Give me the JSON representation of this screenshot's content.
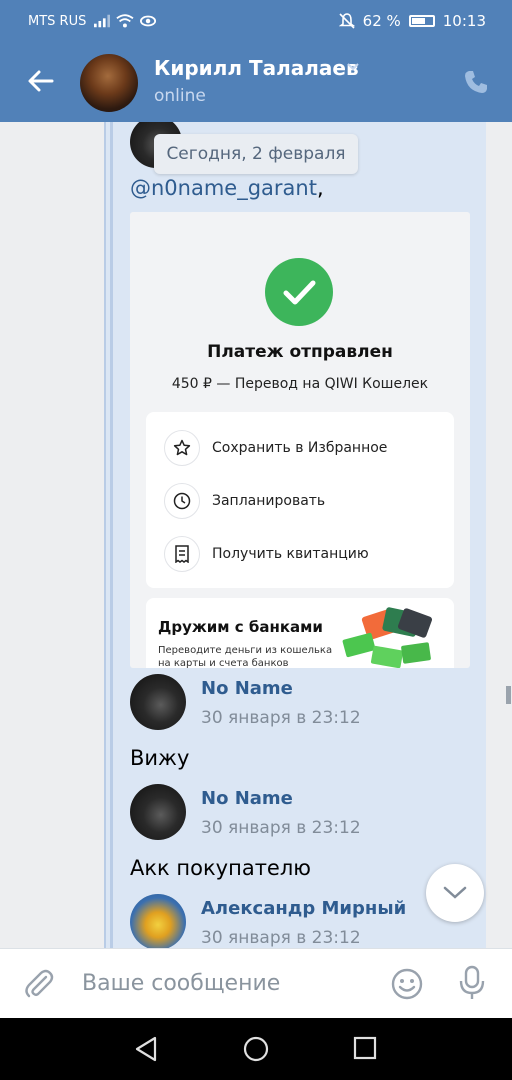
{
  "status_bar": {
    "carrier": "MTS RUS",
    "battery": "62 %",
    "time": "10:13"
  },
  "header": {
    "name": "Кирилл Талалаев",
    "status": "online"
  },
  "chat": {
    "date_pill": "Сегодня, 2 февраля",
    "mention": {
      "link": "@n0name_garant",
      "suffix": ","
    },
    "card": {
      "title": "Платеж отправлен",
      "subtitle": "450 ₽ — Перевод на QIWI Кошелек",
      "actions": [
        {
          "label": "Сохранить в Избранное",
          "icon": "star-icon"
        },
        {
          "label": "Запланировать",
          "icon": "clock-icon"
        },
        {
          "label": "Получить квитанцию",
          "icon": "receipt-icon"
        }
      ],
      "promo": {
        "title": "Дружим с банками",
        "text": "Переводите деньги из кошелька на карты и счета банков"
      }
    },
    "messages": [
      {
        "name": "No Name",
        "time": "30 января в 23:12",
        "text": "Вижу"
      },
      {
        "name": "No Name",
        "time": "30 января в 23:12",
        "text": "Акк покупателю"
      },
      {
        "name": "Александр Мирный",
        "time": "30 января в 23:12",
        "text": ""
      }
    ]
  },
  "composer": {
    "placeholder": "Ваше сообщение"
  },
  "colors": {
    "header": "#5181b8",
    "thread": "#dbe6f4",
    "link": "#2f5c8f",
    "check": "#3db55b"
  }
}
